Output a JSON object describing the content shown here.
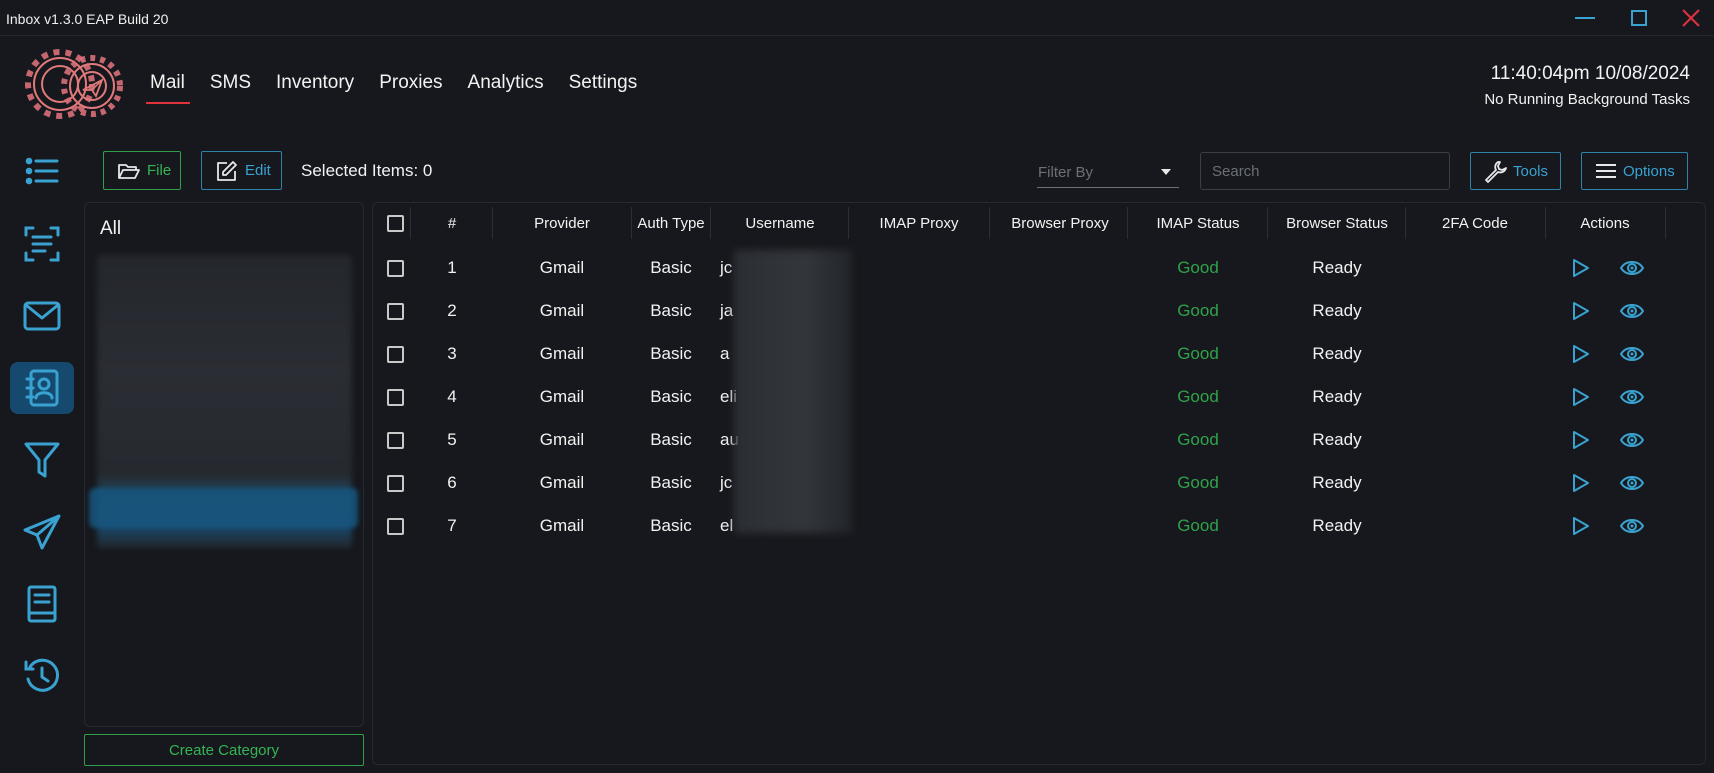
{
  "window": {
    "title": "Inbox v1.3.0 EAP Build 20"
  },
  "nav": {
    "items": [
      "Mail",
      "SMS",
      "Inventory",
      "Proxies",
      "Analytics",
      "Settings"
    ],
    "active": "Mail"
  },
  "header": {
    "clock": "11:40:04pm 10/08/2024",
    "background_tasks": "No Running Background Tasks"
  },
  "sidebar": {
    "icons": [
      "list-icon",
      "document-lines-icon",
      "mail-icon",
      "contacts-book-icon",
      "filter-icon",
      "send-icon",
      "notebook-icon",
      "history-icon"
    ],
    "active": "contacts-book-icon"
  },
  "toolbar": {
    "file_label": "File",
    "edit_label": "Edit",
    "selected_items": "Selected Items: 0",
    "filter_placeholder": "Filter By",
    "search_placeholder": "Search",
    "tools_label": "Tools",
    "options_label": "Options"
  },
  "categories": {
    "all_label": "All",
    "create_label": "Create Category"
  },
  "table": {
    "columns": [
      "#",
      "Provider",
      "Auth Type",
      "Username",
      "IMAP Proxy",
      "Browser Proxy",
      "IMAP Status",
      "Browser Status",
      "2FA Code",
      "Actions"
    ],
    "rows": [
      {
        "num": "1",
        "provider": "Gmail",
        "auth": "Basic",
        "user": "jc",
        "imap_proxy": "",
        "browser_proxy": "",
        "imap_status": "Good",
        "browser_status": "Ready",
        "twofa": ""
      },
      {
        "num": "2",
        "provider": "Gmail",
        "auth": "Basic",
        "user": "ja",
        "imap_proxy": "",
        "browser_proxy": "",
        "imap_status": "Good",
        "browser_status": "Ready",
        "twofa": ""
      },
      {
        "num": "3",
        "provider": "Gmail",
        "auth": "Basic",
        "user": "a",
        "imap_proxy": "",
        "browser_proxy": "",
        "imap_status": "Good",
        "browser_status": "Ready",
        "twofa": ""
      },
      {
        "num": "4",
        "provider": "Gmail",
        "auth": "Basic",
        "user": "eli",
        "imap_proxy": "",
        "browser_proxy": "",
        "imap_status": "Good",
        "browser_status": "Ready",
        "twofa": ""
      },
      {
        "num": "5",
        "provider": "Gmail",
        "auth": "Basic",
        "user": "au",
        "imap_proxy": "",
        "browser_proxy": "",
        "imap_status": "Good",
        "browser_status": "Ready",
        "twofa": ""
      },
      {
        "num": "6",
        "provider": "Gmail",
        "auth": "Basic",
        "user": "jc",
        "imap_proxy": "",
        "browser_proxy": "",
        "imap_status": "Good",
        "browser_status": "Ready",
        "twofa": ""
      },
      {
        "num": "7",
        "provider": "Gmail",
        "auth": "Basic",
        "user": "el",
        "imap_proxy": "",
        "browser_proxy": "",
        "imap_status": "Good",
        "browser_status": "Ready",
        "twofa": ""
      }
    ]
  },
  "colors": {
    "accent_blue": "#3aa2d1",
    "accent_green": "#36b454",
    "nav_underline": "#e0323c",
    "close_red": "#e0323c",
    "background": "#16181d"
  }
}
